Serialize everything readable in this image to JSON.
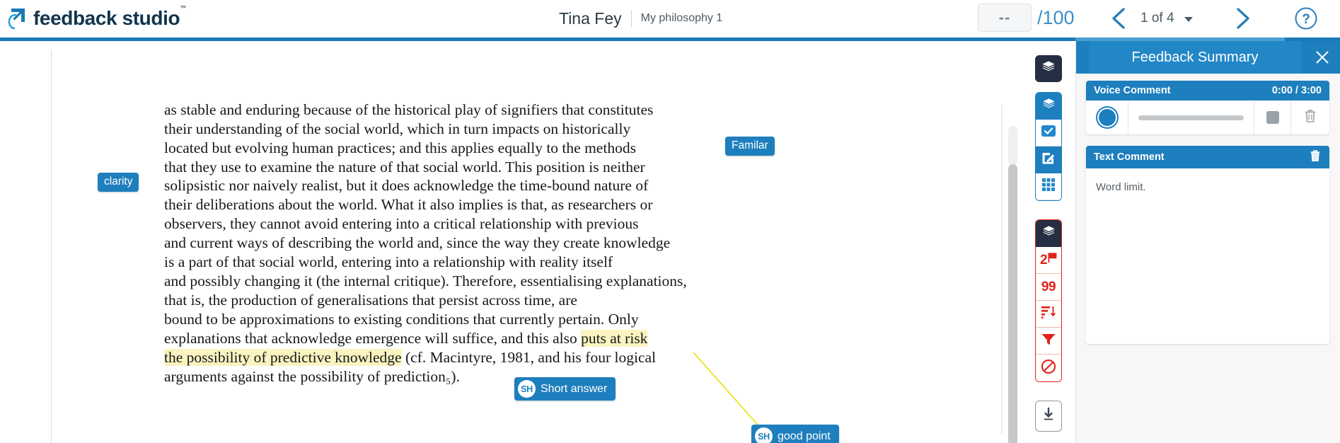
{
  "app": {
    "logo_text": "feedback studio",
    "logo_tm": "™",
    "logo_icon": "arrow-in-square-icon"
  },
  "header": {
    "student_name": "Tina Fey",
    "paper_title": "My philosophy 1",
    "grade_value": "--",
    "grade_max": "/100",
    "prev_icon": "chevron-left-icon",
    "next_icon": "chevron-right-icon",
    "page_label": "1 of 4",
    "page_caret_icon": "caret-down-icon",
    "help_icon": "question-circle-icon",
    "accent_color": "#1b79b8",
    "accent_light": "#4a9ed0"
  },
  "left_tab": {
    "icon": "drag-handle-bars-icon"
  },
  "document": {
    "clipped_line": "as stable and enduring because of the historical play of signifiers that constitutes",
    "body_before_highlight": "their understanding of the social world, which in turn impacts on historically\nlocated but evolving human practices; and this applies equally to the methods\nthat they use to examine the nature of that social world. This position is neither\nsolipsistic nor naively realist, but it does acknowledge the time-bound nature of\ntheir deliberations about the world. What it also implies is that, as researchers or\nobservers, they cannot avoid entering into a critical relationship with previous\nand current ways of describing the world and, since the way they create knowledge\nis a part of that social world, entering into a relationship with reality itself\nand possibly changing it (the internal critique). Therefore, essentialising explanations,\nthat is, the production of generalisations that persist across time, are\nbound to be approximations to existing conditions that currently pertain. Only\nexplanations that acknowledge emergence will suffice, and this also ",
    "highlight_1": "puts at risk",
    "body_mid": "\n",
    "highlight_2": "the possibility of predictive knowledge",
    "body_after_highlight": " (cf. Macintyre, 1981, and his four logical\narguments against the possibility of prediction₅).",
    "highlight_color": "#fbf3c0"
  },
  "quickmarks": [
    {
      "label": "clarity",
      "badge": "",
      "kind": "plain"
    },
    {
      "label": "Familar",
      "badge": "",
      "kind": "plain"
    },
    {
      "label": "Short answer",
      "badge": "SH",
      "kind": "badged"
    },
    {
      "label": "good point",
      "badge": "SH",
      "kind": "badged"
    }
  ],
  "toolbars": {
    "layers_button_icon": "layers-icon",
    "blue": {
      "border_color": "#1e7fbe",
      "rows": [
        {
          "icon": "layers-icon",
          "label": "",
          "state": "header"
        },
        {
          "icon": "checkmark-box-icon",
          "label": "",
          "state": "plain"
        },
        {
          "icon": "pencil-edit-icon",
          "label": "",
          "state": "active"
        },
        {
          "icon": "grid-rubric-icon",
          "label": "",
          "state": "plain"
        }
      ]
    },
    "red": {
      "border_color": "#e32119",
      "rows": [
        {
          "icon": "layers-icon",
          "label": "",
          "state": "header"
        },
        {
          "icon": "flag-icon",
          "label": "2",
          "state": "plain"
        },
        {
          "icon": "",
          "label": "99",
          "state": "plain"
        },
        {
          "icon": "sort-descending-icon",
          "label": "",
          "state": "plain"
        },
        {
          "icon": "filter-funnel-icon",
          "label": "",
          "state": "plain"
        },
        {
          "icon": "prohibited-circle-icon",
          "label": "",
          "state": "plain"
        }
      ]
    },
    "download_icon": "download-icon"
  },
  "right_panel": {
    "title": "Feedback Summary",
    "close_icon": "close-x-icon",
    "voice_comment": {
      "title": "Voice Comment",
      "time": "0:00 / 3:00",
      "record_icon": "record-circle-icon",
      "stop_icon": "stop-square-icon",
      "delete_icon": "trash-icon"
    },
    "text_comment": {
      "title": "Text Comment",
      "delete_icon": "trash-icon",
      "body": "Word limit."
    },
    "accent_color": "#1e7fbe"
  },
  "scrollbar": {
    "icon": "vertical-scrollbar"
  }
}
